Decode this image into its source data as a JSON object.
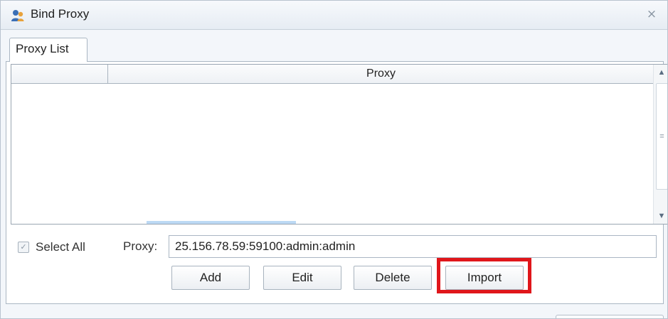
{
  "window": {
    "title": "Bind Proxy",
    "close_glyph": "⨯"
  },
  "tab": {
    "label": "Proxy List"
  },
  "grid": {
    "columns": [
      "",
      "Proxy"
    ],
    "rows": []
  },
  "select_all": {
    "label": "Select All",
    "checked": true
  },
  "proxy_field": {
    "label": "Proxy:",
    "value": "25.156.78.59:59100:admin:admin"
  },
  "buttons": {
    "add": "Add",
    "edit": "Edit",
    "delete": "Delete",
    "import": "Import"
  },
  "icons": {
    "title_icon": "user-icon",
    "close_icon": "close-icon",
    "scroll_up": "chevron-up-icon",
    "scroll_down": "chevron-down-icon"
  },
  "colors": {
    "highlight": "#e0161b",
    "accent": "#bcd9f4"
  }
}
